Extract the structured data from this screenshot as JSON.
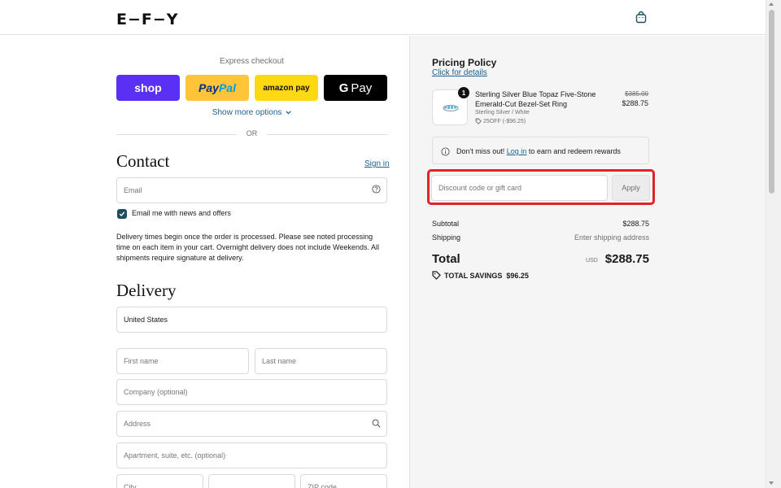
{
  "header": {
    "logo": "E−F−Y",
    "cart_icon": "shopping-bag-icon"
  },
  "express": {
    "title": "Express checkout",
    "shop_label": "shop",
    "paypal_label_1": "Pay",
    "paypal_label_2": "Pal",
    "amazon_label": "amazon pay",
    "gpay_g": "G",
    "gpay_label": "Pay",
    "show_more": "Show more options",
    "or": "OR"
  },
  "contact": {
    "title": "Contact",
    "sign_in": "Sign in",
    "email_placeholder": "Email",
    "news_label": "Email me with news and offers",
    "notice": "Delivery times begin once the order is processed. Please see noted processing time on each item in your cart. Overnight delivery does not include Weekends. All shipments require signature at delivery."
  },
  "delivery": {
    "title": "Delivery",
    "country": "United States",
    "first_name_placeholder": "First name",
    "last_name_placeholder": "Last name",
    "company_placeholder": "Company (optional)",
    "address_placeholder": "Address",
    "apartment_placeholder": "Apartment, suite, etc. (optional)",
    "city_placeholder": "City",
    "zip_placeholder": "ZIP code"
  },
  "summary": {
    "pricing_title": "Pricing Policy",
    "pricing_link": "Click for details",
    "product": {
      "qty": "1",
      "name": "Sterling Silver Blue Topaz Five-Stone Emerald-Cut Bezel-Set Ring",
      "variant": "Sterling Silver / White",
      "discount": "25OFF (-$96.25)",
      "old_price": "$385.00",
      "price": "$288.75"
    },
    "notice_pre": "Don't miss out!",
    "notice_link": "Log in",
    "notice_post": "to earn and redeem rewards",
    "discount_placeholder": "Discount code or gift card",
    "apply_label": "Apply",
    "subtotal_label": "Subtotal",
    "subtotal_value": "$288.75",
    "shipping_label": "Shipping",
    "shipping_value": "Enter shipping address",
    "total_label": "Total",
    "currency": "USD",
    "total_value": "$288.75",
    "savings": "TOTAL SAVINGS  $96.25"
  },
  "colors": {
    "shop": "#5a31f4",
    "paypal": "#ffc439",
    "amazon": "#ffd814",
    "gpay": "#000000",
    "accent": "#1f4d5f",
    "highlight": "#e0222d"
  }
}
